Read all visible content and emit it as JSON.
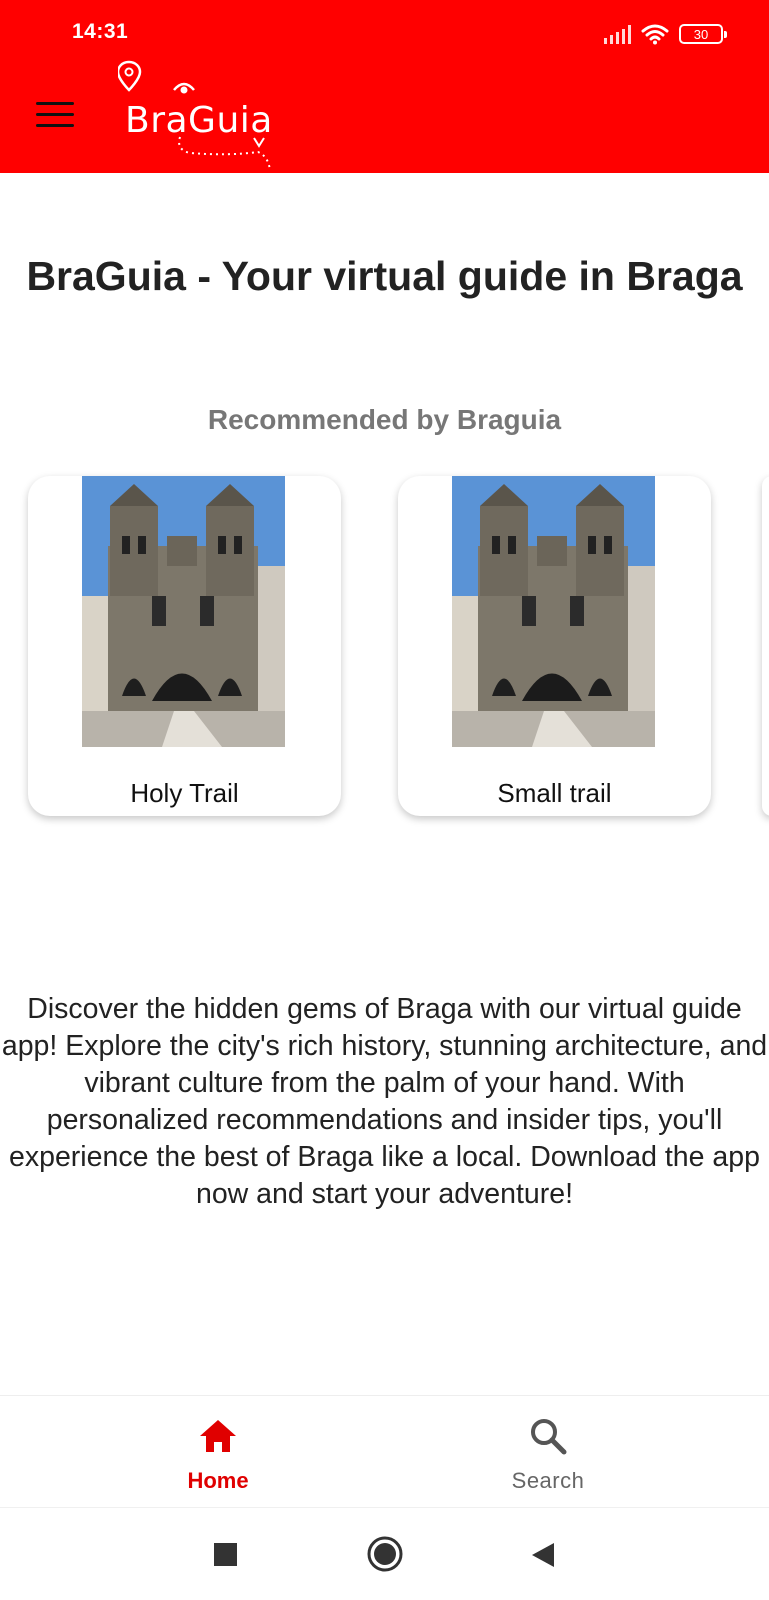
{
  "status_bar": {
    "time": "14:31",
    "battery": "30",
    "icons": [
      "signal-icon",
      "wifi-icon",
      "battery-icon"
    ]
  },
  "app_bar": {
    "logo_text": "BraGuia",
    "menu_icon": "hamburger-menu-icon",
    "background_color": "#ff0000"
  },
  "main": {
    "title": "BraGuia - Your virtual guide in Braga",
    "recommended_title": "Recommended by Braguia",
    "trails": [
      {
        "name": "Holy Trail",
        "image": "braga-cathedral-photo"
      },
      {
        "name": "Small trail",
        "image": "braga-cathedral-photo"
      }
    ],
    "description": "Discover the hidden gems of Braga with our virtual guide app! Explore the city's rich history, stunning architecture, and vibrant culture from the palm of your hand. With personalized recommendations and insider tips, you'll experience the best of Braga like a local. Download the app now and start your adventure!"
  },
  "bottom_nav": {
    "items": [
      {
        "label": "Home",
        "icon": "home-icon",
        "active": true
      },
      {
        "label": "Search",
        "icon": "search-icon",
        "active": false
      }
    ],
    "active_color": "#e00000",
    "inactive_color": "#666666"
  },
  "system_nav": [
    "recents-button",
    "home-button",
    "back-button"
  ]
}
